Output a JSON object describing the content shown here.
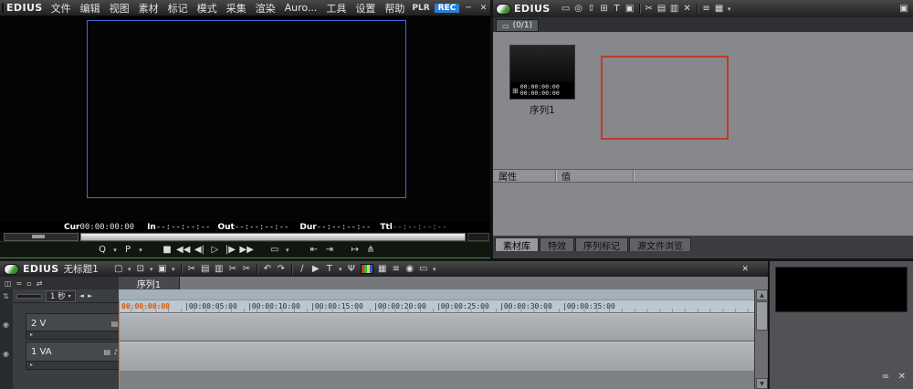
{
  "colors": {
    "rec_active_blue": "#2e7fd6",
    "preview_outline_blue": "#3d6fd6",
    "selection_red": "#c0392b",
    "playhead_orange": "#e8720c",
    "active_window_green": "#3f8a3f"
  },
  "player": {
    "brand": "EDIUS",
    "menus": [
      "文件",
      "编辑",
      "视图",
      "素材",
      "标记",
      "模式",
      "采集",
      "渲染",
      "Auro...",
      "工具",
      "设置",
      "帮助"
    ],
    "plr": "PLR",
    "rec": "REC",
    "minimize": "─",
    "close": "✕",
    "timecode": {
      "cur_label": "Cur",
      "cur_value": "00:00:00:00",
      "in_label": "In",
      "in_value": "--:--:--:--",
      "out_label": "Out",
      "out_value": "--:--:--:--",
      "dur_label": "Dur",
      "dur_value": "--:--:--:--",
      "ttl_label": "Ttl",
      "ttl_value": "--:--:--:--"
    },
    "transport": [
      "Q",
      "▾",
      "P",
      "▾",
      "■",
      "◀◀",
      "◀|",
      "▷",
      "|▶",
      "▶▶",
      "▭",
      "▾",
      "⇤",
      "⇥",
      "↦",
      "⋔"
    ]
  },
  "bin": {
    "brand": "EDIUS",
    "toolbar": [
      "▭",
      "◎",
      "⇧",
      "⊞",
      "T",
      "▣",
      "✂",
      "▤",
      "▥",
      "✕",
      "≡",
      "▦",
      "▾",
      "▣"
    ],
    "folder_icon": "▭",
    "folder_tab": "(0/1)",
    "clip": {
      "icon": "⊞",
      "timecode_top": "00:00:00:00",
      "timecode_bottom": "00:00:00:00",
      "label": "序列1"
    },
    "properties": {
      "col_name": "属性",
      "col_value": "值"
    },
    "tabs": [
      "素材库",
      "特效",
      "序列标记",
      "源文件浏览"
    ]
  },
  "timeline": {
    "brand": "EDIUS",
    "title": "无标题1",
    "close": "✕",
    "toolbar": [
      "▢",
      "▾",
      "⊡",
      "▾",
      "▣",
      "▾",
      "✂",
      "▤",
      "▥",
      "✂",
      "✂",
      "↶",
      "↷",
      "∕",
      "▶",
      "T",
      "▾",
      "Ψ",
      "▦",
      "≡",
      "◉",
      "▭",
      "▾"
    ],
    "row2_icons": [
      "◫",
      "≈",
      "▫",
      "⇄"
    ],
    "sequence_tab": "序列1",
    "zoom": {
      "value": "1 秒",
      "caret": "▾",
      "dec": "◄",
      "inc": "►"
    },
    "ruler": [
      "00:00:00:00",
      "|00:00:05:00",
      "|00:00:10:00",
      "|00:00:15:00",
      "|00:00:20:00",
      "|00:00:25:00",
      "|00:00:30:00",
      "|00:00:35:00"
    ],
    "tracks": [
      {
        "label": "2 V",
        "icon1": "▤",
        "icon2": "⇥"
      },
      {
        "label": "1 VA",
        "icon1": "▤",
        "icon2": "♪",
        "icon3": "⇥"
      }
    ],
    "expander": "▸",
    "left_strip_icons": [
      "⇅",
      "◉",
      "◉"
    ],
    "scrollbar": {
      "up": "▲",
      "down": "▼"
    }
  },
  "aux": {
    "options_icon": "∞",
    "close": "✕"
  }
}
